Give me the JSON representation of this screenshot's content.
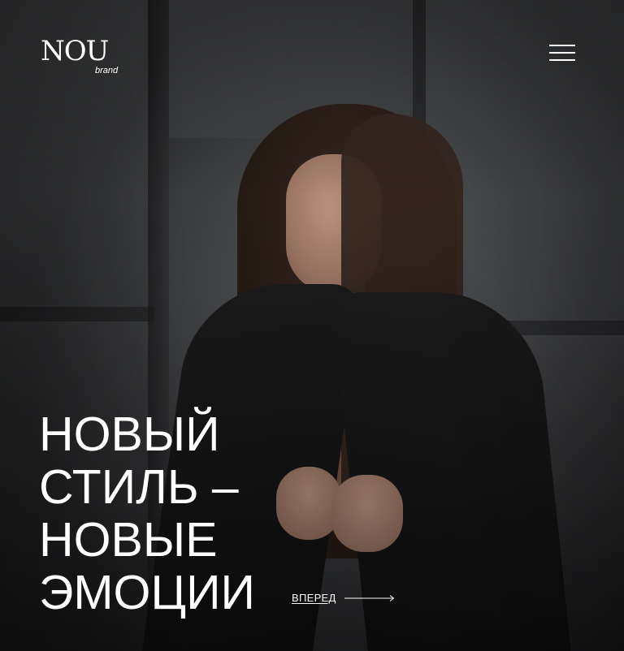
{
  "brand": {
    "logo_text": "NOU",
    "logo_subtext": "brand"
  },
  "header": {
    "menu_icon": "hamburger-menu-icon"
  },
  "hero": {
    "headline_lines": [
      "НОВЫЙ",
      "СТИЛЬ –",
      "НОВЫЕ",
      "ЭМОЦИИ"
    ],
    "forward_label": "ВПЕРЕД",
    "forward_icon": "long-arrow-right-icon"
  },
  "colors": {
    "text": "#ffffff",
    "background": "#4e5053",
    "overlay": "#000000"
  }
}
